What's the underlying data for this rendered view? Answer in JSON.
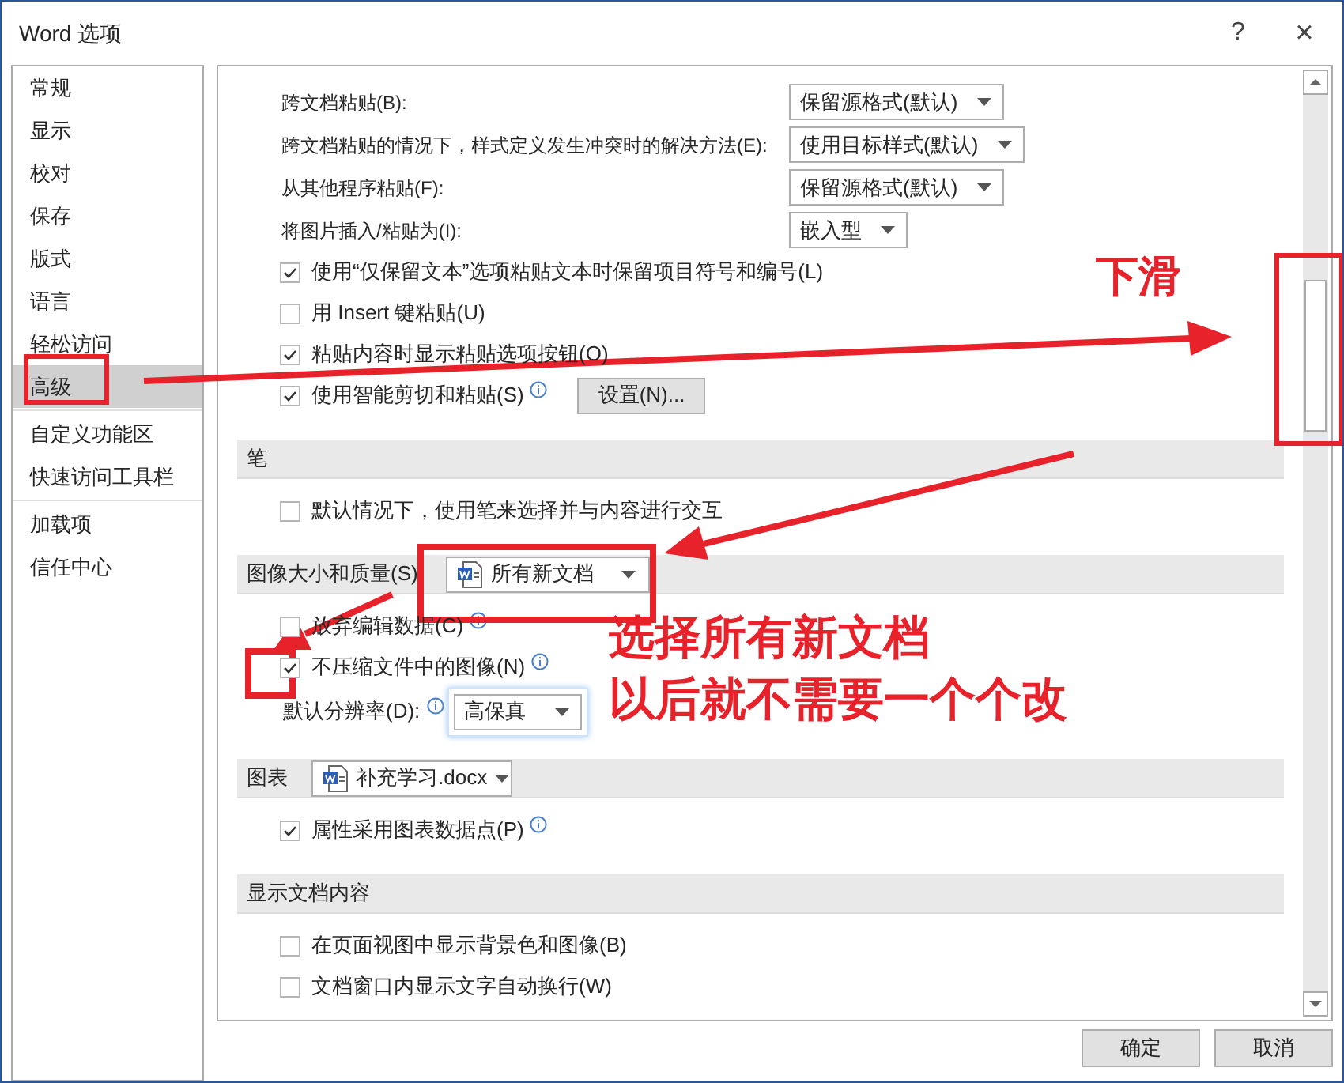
{
  "window": {
    "title": "Word 选项",
    "help": "?",
    "close": "×"
  },
  "sidebar": {
    "groups": [
      [
        {
          "label": "常规",
          "selected": false
        },
        {
          "label": "显示",
          "selected": false
        },
        {
          "label": "校对",
          "selected": false
        },
        {
          "label": "保存",
          "selected": false
        },
        {
          "label": "版式",
          "selected": false
        },
        {
          "label": "语言",
          "selected": false
        },
        {
          "label": "轻松访问",
          "selected": false
        },
        {
          "label": "高级",
          "selected": true
        }
      ],
      [
        {
          "label": "自定义功能区",
          "selected": false
        },
        {
          "label": "快速访问工具栏",
          "selected": false
        }
      ],
      [
        {
          "label": "加载项",
          "selected": false
        },
        {
          "label": "信任中心",
          "selected": false
        }
      ]
    ]
  },
  "sections": [
    {
      "rows": [
        {
          "kind": "select",
          "label": "跨文档粘贴(B):",
          "value": "保留源格式(默认)"
        },
        {
          "kind": "select",
          "label": "跨文档粘贴的情况下，样式定义发生冲突时的解决方法(E):",
          "value": "使用目标样式(默认)"
        },
        {
          "kind": "select",
          "label": "从其他程序粘贴(F):",
          "value": "保留源格式(默认)"
        },
        {
          "kind": "select",
          "label": "将图片插入/粘贴为(I):",
          "value": "嵌入型"
        },
        {
          "kind": "checkbox",
          "label": "使用“仅保留文本”选项粘贴文本时保留项目符号和编号(L)",
          "checked": true
        },
        {
          "kind": "checkbox",
          "label": "用 Insert 键粘贴(U)",
          "checked": false
        },
        {
          "kind": "checkbox",
          "label": "粘贴内容时显示粘贴选项按钮(O)",
          "checked": true
        },
        {
          "kind": "checkbox",
          "label": "使用智能剪切和粘贴(S)",
          "checked": true,
          "info": true,
          "button": "设置(N)..."
        }
      ]
    },
    {
      "title": "笔",
      "rows": [
        {
          "kind": "checkbox",
          "label": "默认情况下，使用笔来选择并与内容进行交互",
          "checked": false
        }
      ]
    },
    {
      "title": "图像大小和质量(S)",
      "select": "所有新文档",
      "rows": [
        {
          "kind": "checkbox",
          "label": "放弃编辑数据(C)",
          "checked": false,
          "info": true
        },
        {
          "kind": "checkbox",
          "label": "不压缩文件中的图像(N)",
          "checked": true,
          "info": true
        },
        {
          "kind": "resolution",
          "label": "默认分辨率(D):",
          "value": "高保真",
          "info": true
        }
      ]
    },
    {
      "title": "图表",
      "select": "补充学习.docx",
      "rows": [
        {
          "kind": "checkbox",
          "label": "属性采用图表数据点(P)",
          "checked": true,
          "info": true
        }
      ]
    },
    {
      "title": "显示文档内容",
      "rows": [
        {
          "kind": "checkbox",
          "label": "在页面视图中显示背景色和图像(B)",
          "checked": false
        },
        {
          "kind": "checkbox",
          "label": "文档窗口内显示文字自动换行(W)",
          "checked": false
        }
      ]
    }
  ],
  "buttons": [
    "确定",
    "取消"
  ],
  "annotations": [
    "下滑",
    "选择所有新文档",
    "以后就不需要一个个改"
  ]
}
